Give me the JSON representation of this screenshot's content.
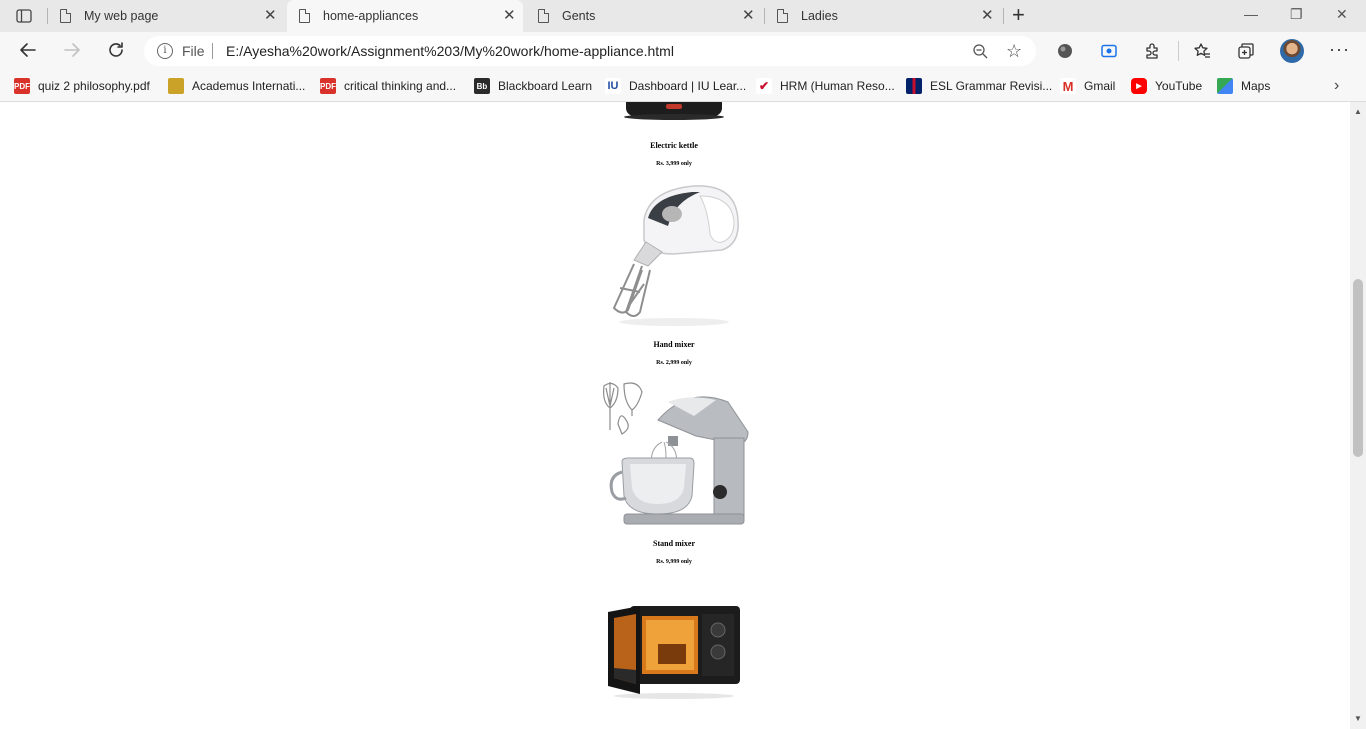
{
  "tabs": [
    {
      "label": "My web page"
    },
    {
      "label": "home-appliances"
    },
    {
      "label": "Gents"
    },
    {
      "label": "Ladies"
    }
  ],
  "address_bar": {
    "scheme_label": "File",
    "url": "E:/Ayesha%20work/Assignment%203/My%20work/home-appliance.html"
  },
  "bookmarks": [
    {
      "label": "quiz 2 philosophy.pdf",
      "icon": "pdf-icon"
    },
    {
      "label": "Academus Internati...",
      "icon": "academus-icon"
    },
    {
      "label": "critical thinking and...",
      "icon": "pdf-icon"
    },
    {
      "label": "Blackboard Learn",
      "icon": "blackboard-icon"
    },
    {
      "label": "Dashboard | IU Lear...",
      "icon": "iu-icon"
    },
    {
      "label": "HRM (Human Reso...",
      "icon": "hrm-icon"
    },
    {
      "label": "ESL Grammar Revisi...",
      "icon": "uk-flag-icon"
    },
    {
      "label": "Gmail",
      "icon": "gmail-icon"
    },
    {
      "label": "YouTube",
      "icon": "youtube-icon"
    },
    {
      "label": "Maps",
      "icon": "maps-icon"
    }
  ],
  "products": [
    {
      "name": "Electric kettle",
      "price": "Rs. 3,999 only"
    },
    {
      "name": "Hand mixer",
      "price": "Rs. 2,999 only"
    },
    {
      "name": "Stand mixer",
      "price": "Rs. 9,999 only"
    }
  ],
  "colors": {
    "tabstrip": "#e8e8e8",
    "toolbar": "#f7f7f7",
    "page": "#ffffff"
  }
}
